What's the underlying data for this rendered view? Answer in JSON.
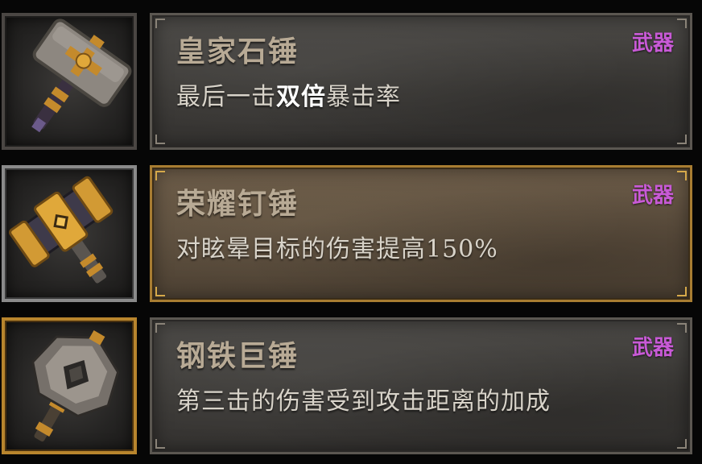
{
  "items": [
    {
      "icon": "stone-hammer-icon",
      "name": "皇家石锤",
      "tag": "武器",
      "desc_pre": "最后一击",
      "desc_bold": "双倍",
      "desc_post": "暴击率",
      "selected": false
    },
    {
      "icon": "golden-hammer-icon",
      "name": "荣耀钉锤",
      "tag": "武器",
      "desc_pre": "对眩晕目标的伤害提高150%",
      "desc_bold": "",
      "desc_post": "",
      "selected": true
    },
    {
      "icon": "spiked-mace-icon",
      "name": "钢铁巨锤",
      "tag": "武器",
      "desc_pre": "第三击的伤害受到攻击距离的加成",
      "desc_bold": "",
      "desc_post": "",
      "selected": false
    }
  ],
  "colors": {
    "tag": "#c85ad6",
    "name": "#b8aa95",
    "desc": "#d8d3c9",
    "selected_border": "#a87d32"
  }
}
